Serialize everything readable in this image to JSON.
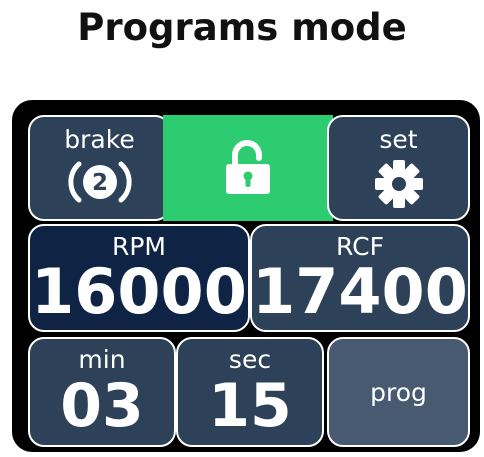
{
  "page": {
    "title": "Programs mode"
  },
  "panel": {
    "brake": {
      "label": "brake",
      "level": "2",
      "icon": "brake-icon"
    },
    "lock": {
      "icon": "unlocked-padlock-icon",
      "state": "unlocked"
    },
    "set": {
      "label": "set",
      "icon": "gear-icon"
    },
    "rpm": {
      "label": "RPM",
      "value": "16000"
    },
    "rcf": {
      "label": "RCF",
      "value": "17400"
    },
    "min": {
      "label": "min",
      "value": "03"
    },
    "sec": {
      "label": "sec",
      "value": "15"
    },
    "prog": {
      "label": "prog"
    }
  },
  "colors": {
    "tile_dark": "#2d4258",
    "tile_navy": "#0f2445",
    "tile_slate": "#475a6f",
    "lock_green": "#2ecc71",
    "frame": "#000000"
  }
}
